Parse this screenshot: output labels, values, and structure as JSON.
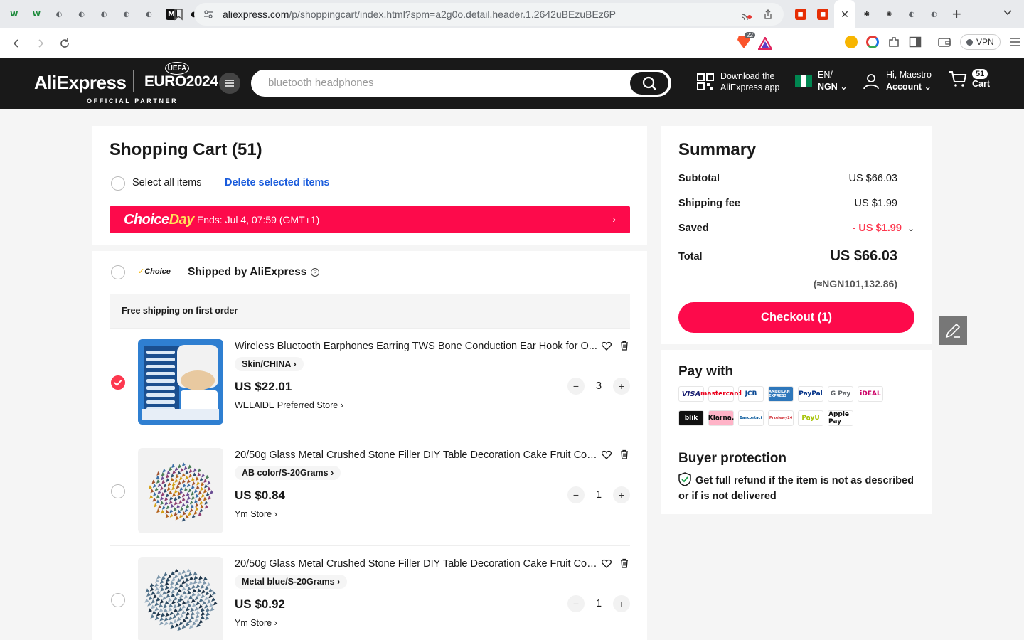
{
  "browser": {
    "tabs": [
      {
        "icon": "W",
        "color": "#1b8a3a",
        "bg": "transparent"
      },
      {
        "icon": "W",
        "color": "#1b8a3a",
        "bg": "transparent"
      },
      {
        "icon": "globe",
        "color": "#5f6368",
        "bg": "transparent"
      },
      {
        "icon": "globe",
        "color": "#5f6368",
        "bg": "transparent"
      },
      {
        "icon": "globe",
        "color": "#5f6368",
        "bg": "transparent"
      },
      {
        "icon": "globe",
        "color": "#5f6368",
        "bg": "transparent"
      },
      {
        "icon": "globe",
        "color": "#5f6368",
        "bg": "transparent"
      },
      {
        "icon": "M",
        "color": "#ffffff",
        "bg": "#111111"
      },
      {
        "icon": "github",
        "color": "#111111",
        "bg": "transparent"
      },
      {
        "icon": "github",
        "color": "#111111",
        "bg": "transparent"
      },
      {
        "icon": "github",
        "color": "#111111",
        "bg": "transparent"
      },
      {
        "icon": "github",
        "color": "#111111",
        "bg": "transparent"
      },
      {
        "icon": "drive",
        "color": "#f4b400",
        "bg": "transparent"
      },
      {
        "icon": "edit",
        "color": "#ffffff",
        "bg": "#3b5bdb"
      },
      {
        "icon": "globe",
        "color": "#5f6368",
        "bg": "transparent"
      },
      {
        "icon": "check",
        "color": "#1a73e8",
        "bg": "transparent"
      },
      {
        "icon": "B",
        "color": "#ffffff",
        "bg": "#9c27b0"
      },
      {
        "icon": "B",
        "color": "#ffffff",
        "bg": "#7b1fa2"
      },
      {
        "icon": "globe",
        "color": "#5f6368",
        "bg": "transparent"
      },
      {
        "icon": "youtube",
        "color": "#ffffff",
        "bg": "#ff0000"
      },
      {
        "icon": "dots",
        "color": "#ffffff",
        "bg": "#e91e63"
      },
      {
        "icon": "chat",
        "color": "#1a73e8",
        "bg": "transparent"
      },
      {
        "icon": "dhl",
        "color": "#d40511",
        "bg": "#ffcc00"
      },
      {
        "icon": "W",
        "color": "#1b8a3a",
        "bg": "transparent"
      },
      {
        "icon": "M",
        "color": "#ffffff",
        "bg": "#111111"
      },
      {
        "icon": "doc",
        "color": "#1a73e8",
        "bg": "transparent"
      },
      {
        "icon": "grammarly",
        "color": "#ffffff",
        "bg": "#15c39a"
      },
      {
        "icon": "slash",
        "color": "#7c4dff",
        "bg": "transparent"
      },
      {
        "icon": "book",
        "color": "#444444",
        "bg": "transparent"
      },
      {
        "icon": "book",
        "color": "#444444",
        "bg": "transparent"
      },
      {
        "icon": "book",
        "color": "#444444",
        "bg": "transparent"
      },
      {
        "icon": "youtube",
        "color": "#ffffff",
        "bg": "#ff0000"
      },
      {
        "icon": "book",
        "color": "#444444",
        "bg": "transparent"
      },
      {
        "icon": "gmail",
        "color": "#ea4335",
        "bg": "transparent"
      },
      {
        "icon": "globe",
        "color": "#5f6368",
        "bg": "transparent"
      },
      {
        "icon": "ae",
        "color": "#ffffff",
        "bg": "#e62e04"
      },
      {
        "icon": "ae",
        "color": "#ffffff",
        "bg": "#e62e04"
      }
    ],
    "active_tab_close": "✕",
    "after_tabs": [
      {
        "icon": "asterisk",
        "color": "#333333"
      },
      {
        "icon": "openai",
        "color": "#333333"
      },
      {
        "icon": "globe",
        "color": "#5f6368"
      },
      {
        "icon": "globe",
        "color": "#5f6368"
      }
    ],
    "new_tab": "+",
    "url_host": "aliexpress.com",
    "url_path": "/p/shoppingcart/index.html?spm=a2g0o.detail.header.1.2642uBEzuBEz6P",
    "shield_count": "22",
    "vpn_label": "VPN"
  },
  "header": {
    "logo": "AliExpress",
    "euro_logo": "EURO2024",
    "uefa": "UEFA",
    "partner": "OFFICIAL PARTNER",
    "search_placeholder": "bluetooth headphones",
    "app_line1": "Download the",
    "app_line2": "AliExpress app",
    "lang_line1": "EN/",
    "lang_line2": "NGN",
    "account_line1": "Hi, Maestro",
    "account_line2": "Account",
    "cart_count": "51",
    "cart_label": "Cart"
  },
  "cart": {
    "title": "Shopping Cart (51)",
    "select_all": "Select all items",
    "delete_selected": "Delete selected items",
    "promo_choice": "Choice",
    "promo_day": "Day",
    "promo_ends": "Ends: Jul 4, 07:59 (GMT+1)",
    "group_choice_tag": "Choice",
    "shipped_by": "Shipped by AliExpress",
    "free_shipping": "Free shipping on first order",
    "items": [
      {
        "title": "Wireless Bluetooth Earphones Earring TWS Bone Conduction Ear Hook for O...",
        "sku": "Skin/CHINA",
        "price": "US $22.01",
        "store": "WELAIDE Preferred Store",
        "qty": "3",
        "checked": true
      },
      {
        "title": "20/50g Glass Metal Crushed Stone Filler DIY Table Decoration Cake Fruit Coa...",
        "sku": "AB color/S-20Grams",
        "price": "US $0.84",
        "store": "Ym Store",
        "qty": "1",
        "checked": false
      },
      {
        "title": "20/50g Glass Metal Crushed Stone Filler DIY Table Decoration Cake Fruit Coa...",
        "sku": "Metal blue/S-20Grams",
        "price": "US $0.92",
        "store": "Ym Store",
        "qty": "1",
        "checked": false
      }
    ]
  },
  "summary": {
    "title": "Summary",
    "subtotal_label": "Subtotal",
    "subtotal": "US $66.03",
    "shipping_label": "Shipping fee",
    "shipping": "US $1.99",
    "saved_label": "Saved",
    "saved": "- US $1.99",
    "total_label": "Total",
    "total": "US $66.03",
    "total_ngn": "(≈NGN101,132.86)",
    "checkout": "Checkout (1)"
  },
  "pay": {
    "title": "Pay with",
    "methods": [
      "VISA",
      "mastercard",
      "JCB",
      "AMERICAN EXPRESS",
      "PayPal",
      "G Pay",
      "iDEAL",
      "blik",
      "Klarna.",
      "Bancontact",
      "Przelewy24",
      "PayU",
      "Apple Pay"
    ],
    "protection_title": "Buyer protection",
    "protection_text": "Get full refund if the item is not as described or if is not delivered"
  },
  "colors": {
    "brand_red": "#fd0a4b",
    "header_bg": "#191919",
    "link_blue": "#1a5cdc"
  }
}
